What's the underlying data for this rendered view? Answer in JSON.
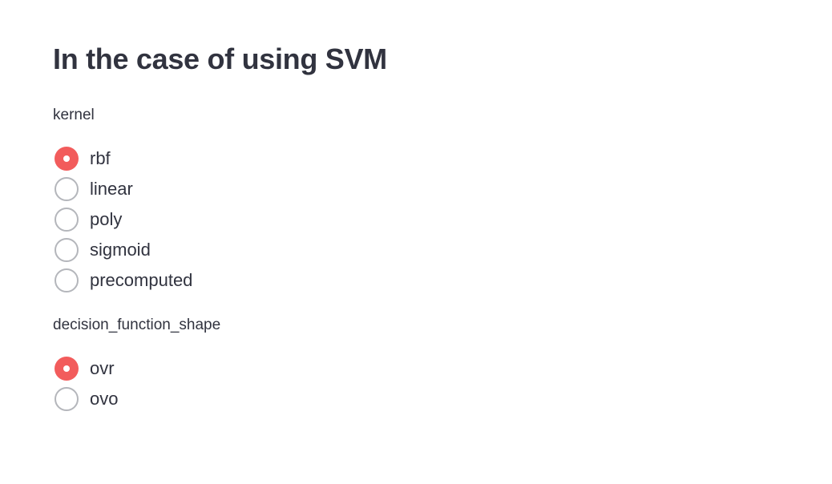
{
  "page": {
    "title": "In the case of using SVM"
  },
  "kernel": {
    "label": "kernel",
    "selected": "rbf",
    "options": [
      "rbf",
      "linear",
      "poly",
      "sigmoid",
      "precomputed"
    ]
  },
  "decision_function_shape": {
    "label": "decision_function_shape",
    "selected": "ovr",
    "options": [
      "ovr",
      "ovo"
    ]
  },
  "colors": {
    "accent": "#f25c5c",
    "text": "#31333f",
    "radio_border": "#b4b6bb",
    "background": "#ffffff"
  }
}
